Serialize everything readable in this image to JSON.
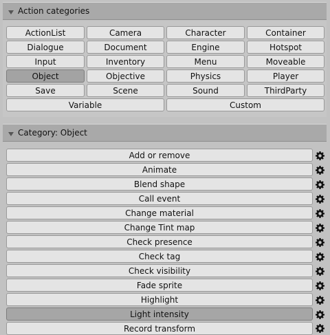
{
  "categories_panel": {
    "title": "Action categories",
    "buttons": [
      "ActionList",
      "Camera",
      "Character",
      "Container",
      "Dialogue",
      "Document",
      "Engine",
      "Hotspot",
      "Input",
      "Inventory",
      "Menu",
      "Moveable",
      "Object",
      "Objective",
      "Physics",
      "Player",
      "Save",
      "Scene",
      "Sound",
      "ThirdParty"
    ],
    "bottom_buttons": [
      "Variable",
      "Custom"
    ],
    "selected": "Object"
  },
  "category_panel": {
    "title": "Category: Object",
    "actions": [
      "Add or remove",
      "Animate",
      "Blend shape",
      "Call event",
      "Change material",
      "Change Tint map",
      "Check presence",
      "Check tag",
      "Check visibility",
      "Fade sprite",
      "Highlight",
      "Light intensity",
      "Record transform"
    ],
    "selected": "Light intensity"
  },
  "icons": {
    "settings": "gear-icon",
    "collapse": "triangle-down-icon"
  }
}
